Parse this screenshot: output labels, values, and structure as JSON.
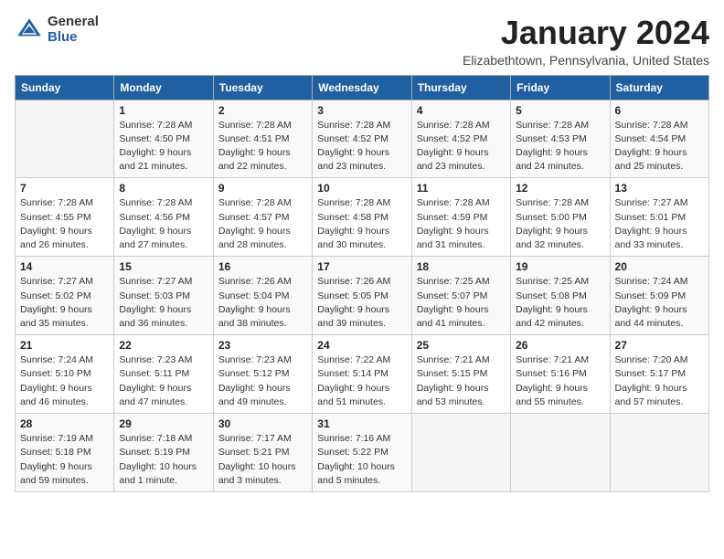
{
  "header": {
    "logo_general": "General",
    "logo_blue": "Blue",
    "month_title": "January 2024",
    "location": "Elizabethtown, Pennsylvania, United States"
  },
  "weekdays": [
    "Sunday",
    "Monday",
    "Tuesday",
    "Wednesday",
    "Thursday",
    "Friday",
    "Saturday"
  ],
  "weeks": [
    [
      {
        "day": "",
        "sunrise": "",
        "sunset": "",
        "daylight": ""
      },
      {
        "day": "1",
        "sunrise": "Sunrise: 7:28 AM",
        "sunset": "Sunset: 4:50 PM",
        "daylight": "Daylight: 9 hours and 21 minutes."
      },
      {
        "day": "2",
        "sunrise": "Sunrise: 7:28 AM",
        "sunset": "Sunset: 4:51 PM",
        "daylight": "Daylight: 9 hours and 22 minutes."
      },
      {
        "day": "3",
        "sunrise": "Sunrise: 7:28 AM",
        "sunset": "Sunset: 4:52 PM",
        "daylight": "Daylight: 9 hours and 23 minutes."
      },
      {
        "day": "4",
        "sunrise": "Sunrise: 7:28 AM",
        "sunset": "Sunset: 4:52 PM",
        "daylight": "Daylight: 9 hours and 23 minutes."
      },
      {
        "day": "5",
        "sunrise": "Sunrise: 7:28 AM",
        "sunset": "Sunset: 4:53 PM",
        "daylight": "Daylight: 9 hours and 24 minutes."
      },
      {
        "day": "6",
        "sunrise": "Sunrise: 7:28 AM",
        "sunset": "Sunset: 4:54 PM",
        "daylight": "Daylight: 9 hours and 25 minutes."
      }
    ],
    [
      {
        "day": "7",
        "sunrise": "Sunrise: 7:28 AM",
        "sunset": "Sunset: 4:55 PM",
        "daylight": "Daylight: 9 hours and 26 minutes."
      },
      {
        "day": "8",
        "sunrise": "Sunrise: 7:28 AM",
        "sunset": "Sunset: 4:56 PM",
        "daylight": "Daylight: 9 hours and 27 minutes."
      },
      {
        "day": "9",
        "sunrise": "Sunrise: 7:28 AM",
        "sunset": "Sunset: 4:57 PM",
        "daylight": "Daylight: 9 hours and 28 minutes."
      },
      {
        "day": "10",
        "sunrise": "Sunrise: 7:28 AM",
        "sunset": "Sunset: 4:58 PM",
        "daylight": "Daylight: 9 hours and 30 minutes."
      },
      {
        "day": "11",
        "sunrise": "Sunrise: 7:28 AM",
        "sunset": "Sunset: 4:59 PM",
        "daylight": "Daylight: 9 hours and 31 minutes."
      },
      {
        "day": "12",
        "sunrise": "Sunrise: 7:28 AM",
        "sunset": "Sunset: 5:00 PM",
        "daylight": "Daylight: 9 hours and 32 minutes."
      },
      {
        "day": "13",
        "sunrise": "Sunrise: 7:27 AM",
        "sunset": "Sunset: 5:01 PM",
        "daylight": "Daylight: 9 hours and 33 minutes."
      }
    ],
    [
      {
        "day": "14",
        "sunrise": "Sunrise: 7:27 AM",
        "sunset": "Sunset: 5:02 PM",
        "daylight": "Daylight: 9 hours and 35 minutes."
      },
      {
        "day": "15",
        "sunrise": "Sunrise: 7:27 AM",
        "sunset": "Sunset: 5:03 PM",
        "daylight": "Daylight: 9 hours and 36 minutes."
      },
      {
        "day": "16",
        "sunrise": "Sunrise: 7:26 AM",
        "sunset": "Sunset: 5:04 PM",
        "daylight": "Daylight: 9 hours and 38 minutes."
      },
      {
        "day": "17",
        "sunrise": "Sunrise: 7:26 AM",
        "sunset": "Sunset: 5:05 PM",
        "daylight": "Daylight: 9 hours and 39 minutes."
      },
      {
        "day": "18",
        "sunrise": "Sunrise: 7:25 AM",
        "sunset": "Sunset: 5:07 PM",
        "daylight": "Daylight: 9 hours and 41 minutes."
      },
      {
        "day": "19",
        "sunrise": "Sunrise: 7:25 AM",
        "sunset": "Sunset: 5:08 PM",
        "daylight": "Daylight: 9 hours and 42 minutes."
      },
      {
        "day": "20",
        "sunrise": "Sunrise: 7:24 AM",
        "sunset": "Sunset: 5:09 PM",
        "daylight": "Daylight: 9 hours and 44 minutes."
      }
    ],
    [
      {
        "day": "21",
        "sunrise": "Sunrise: 7:24 AM",
        "sunset": "Sunset: 5:10 PM",
        "daylight": "Daylight: 9 hours and 46 minutes."
      },
      {
        "day": "22",
        "sunrise": "Sunrise: 7:23 AM",
        "sunset": "Sunset: 5:11 PM",
        "daylight": "Daylight: 9 hours and 47 minutes."
      },
      {
        "day": "23",
        "sunrise": "Sunrise: 7:23 AM",
        "sunset": "Sunset: 5:12 PM",
        "daylight": "Daylight: 9 hours and 49 minutes."
      },
      {
        "day": "24",
        "sunrise": "Sunrise: 7:22 AM",
        "sunset": "Sunset: 5:14 PM",
        "daylight": "Daylight: 9 hours and 51 minutes."
      },
      {
        "day": "25",
        "sunrise": "Sunrise: 7:21 AM",
        "sunset": "Sunset: 5:15 PM",
        "daylight": "Daylight: 9 hours and 53 minutes."
      },
      {
        "day": "26",
        "sunrise": "Sunrise: 7:21 AM",
        "sunset": "Sunset: 5:16 PM",
        "daylight": "Daylight: 9 hours and 55 minutes."
      },
      {
        "day": "27",
        "sunrise": "Sunrise: 7:20 AM",
        "sunset": "Sunset: 5:17 PM",
        "daylight": "Daylight: 9 hours and 57 minutes."
      }
    ],
    [
      {
        "day": "28",
        "sunrise": "Sunrise: 7:19 AM",
        "sunset": "Sunset: 5:18 PM",
        "daylight": "Daylight: 9 hours and 59 minutes."
      },
      {
        "day": "29",
        "sunrise": "Sunrise: 7:18 AM",
        "sunset": "Sunset: 5:19 PM",
        "daylight": "Daylight: 10 hours and 1 minute."
      },
      {
        "day": "30",
        "sunrise": "Sunrise: 7:17 AM",
        "sunset": "Sunset: 5:21 PM",
        "daylight": "Daylight: 10 hours and 3 minutes."
      },
      {
        "day": "31",
        "sunrise": "Sunrise: 7:16 AM",
        "sunset": "Sunset: 5:22 PM",
        "daylight": "Daylight: 10 hours and 5 minutes."
      },
      {
        "day": "",
        "sunrise": "",
        "sunset": "",
        "daylight": ""
      },
      {
        "day": "",
        "sunrise": "",
        "sunset": "",
        "daylight": ""
      },
      {
        "day": "",
        "sunrise": "",
        "sunset": "",
        "daylight": ""
      }
    ]
  ]
}
